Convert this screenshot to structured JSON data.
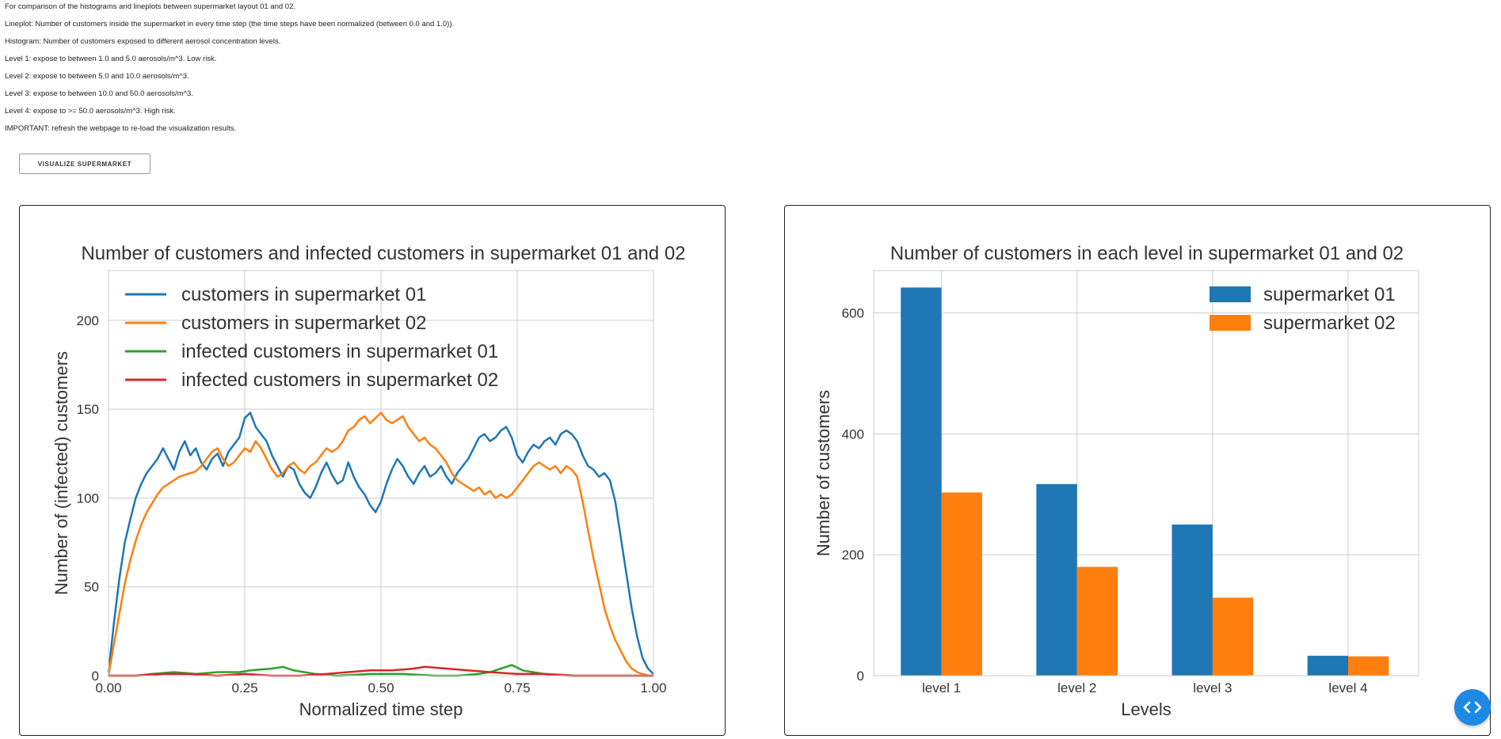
{
  "info_lines": [
    "For comparison of the histograms and lineplots between supermarket layout 01 and 02.",
    "Lineplot: Number of customers inside the supermarket in every time step (the time steps have been normalized (between 0.0 and 1.0)).",
    "Histogram: Number of customers exposed to different aerosol concentration levels.",
    "Level 1: expose to between 1.0 and 5.0 aerosols/m^3. Low risk.",
    "Level 2: expose to between 5.0 and 10.0 aerosols/m^3.",
    "Level 3: expose to between 10.0 and 50.0 aerosols/m^3.",
    "Level 4: expose to >= 50.0 aerosols/m^3. High risk.",
    "IMPORTANT: refresh the webpage to re-load the visualization results."
  ],
  "visualize_button": "VISUALIZE SUPERMARKET",
  "fab_icon": "code-icon",
  "colors": {
    "blue": "#1f77b4",
    "orange": "#ff7f0e",
    "green": "#2ca02c",
    "red": "#d62728"
  },
  "chart_data": [
    {
      "type": "line",
      "title": "Number of customers and infected customers in supermarket 01 and 02",
      "xlabel": "Normalized time step",
      "ylabel": "Number of (infected) customers",
      "xlim": [
        0.0,
        1.0
      ],
      "ylim": [
        0,
        228
      ],
      "xticks": [
        0.0,
        0.25,
        0.5,
        0.75,
        1.0
      ],
      "xtick_labels": [
        "0.00",
        "0.25",
        "0.50",
        "0.75",
        "1.00"
      ],
      "yticks": [
        0,
        50,
        100,
        150,
        200
      ],
      "ytick_labels": [
        "0",
        "50",
        "100",
        "150",
        "200"
      ],
      "grid": true,
      "legend_position": "top-left",
      "series": [
        {
          "name": "customers in supermarket 01",
          "color": "#1f77b4",
          "x": [
            0.0,
            0.01,
            0.02,
            0.03,
            0.04,
            0.05,
            0.06,
            0.07,
            0.08,
            0.09,
            0.1,
            0.11,
            0.12,
            0.13,
            0.14,
            0.15,
            0.16,
            0.17,
            0.18,
            0.19,
            0.2,
            0.21,
            0.22,
            0.23,
            0.24,
            0.25,
            0.26,
            0.27,
            0.28,
            0.29,
            0.3,
            0.31,
            0.32,
            0.33,
            0.34,
            0.35,
            0.36,
            0.37,
            0.38,
            0.39,
            0.4,
            0.41,
            0.42,
            0.43,
            0.44,
            0.45,
            0.46,
            0.47,
            0.48,
            0.49,
            0.5,
            0.51,
            0.52,
            0.53,
            0.54,
            0.55,
            0.56,
            0.57,
            0.58,
            0.59,
            0.6,
            0.61,
            0.62,
            0.63,
            0.64,
            0.65,
            0.66,
            0.67,
            0.68,
            0.69,
            0.7,
            0.71,
            0.72,
            0.73,
            0.74,
            0.75,
            0.76,
            0.77,
            0.78,
            0.79,
            0.8,
            0.81,
            0.82,
            0.83,
            0.84,
            0.85,
            0.86,
            0.87,
            0.88,
            0.89,
            0.9,
            0.91,
            0.92,
            0.93,
            0.94,
            0.95,
            0.96,
            0.97,
            0.98,
            0.99,
            1.0
          ],
          "y": [
            2,
            30,
            55,
            75,
            88,
            100,
            108,
            114,
            118,
            122,
            128,
            122,
            116,
            126,
            132,
            124,
            128,
            120,
            116,
            122,
            125,
            118,
            126,
            130,
            134,
            145,
            148,
            140,
            136,
            132,
            124,
            118,
            112,
            118,
            116,
            108,
            103,
            100,
            106,
            114,
            120,
            113,
            108,
            110,
            120,
            112,
            106,
            102,
            96,
            92,
            98,
            108,
            116,
            122,
            118,
            112,
            108,
            114,
            118,
            112,
            114,
            118,
            112,
            108,
            114,
            118,
            122,
            128,
            134,
            136,
            132,
            134,
            138,
            140,
            134,
            124,
            120,
            126,
            130,
            128,
            132,
            134,
            130,
            136,
            138,
            136,
            132,
            124,
            118,
            116,
            112,
            114,
            110,
            98,
            78,
            58,
            38,
            22,
            10,
            4,
            1
          ]
        },
        {
          "name": "customers in supermarket 02",
          "color": "#ff7f0e",
          "x": [
            0.0,
            0.01,
            0.02,
            0.03,
            0.04,
            0.05,
            0.06,
            0.07,
            0.08,
            0.09,
            0.1,
            0.11,
            0.12,
            0.13,
            0.14,
            0.15,
            0.16,
            0.17,
            0.18,
            0.19,
            0.2,
            0.21,
            0.22,
            0.23,
            0.24,
            0.25,
            0.26,
            0.27,
            0.28,
            0.29,
            0.3,
            0.31,
            0.32,
            0.33,
            0.34,
            0.35,
            0.36,
            0.37,
            0.38,
            0.39,
            0.4,
            0.41,
            0.42,
            0.43,
            0.44,
            0.45,
            0.46,
            0.47,
            0.48,
            0.49,
            0.5,
            0.51,
            0.52,
            0.53,
            0.54,
            0.55,
            0.56,
            0.57,
            0.58,
            0.59,
            0.6,
            0.61,
            0.62,
            0.63,
            0.64,
            0.65,
            0.66,
            0.67,
            0.68,
            0.69,
            0.7,
            0.71,
            0.72,
            0.73,
            0.74,
            0.75,
            0.76,
            0.77,
            0.78,
            0.79,
            0.8,
            0.81,
            0.82,
            0.83,
            0.84,
            0.85,
            0.86,
            0.87,
            0.88,
            0.89,
            0.9,
            0.91,
            0.92,
            0.93,
            0.94,
            0.95,
            0.96,
            0.97,
            0.98,
            0.99,
            1.0
          ],
          "y": [
            0,
            18,
            35,
            52,
            65,
            76,
            85,
            92,
            97,
            102,
            106,
            108,
            110,
            112,
            113,
            114,
            115,
            118,
            122,
            126,
            128,
            122,
            118,
            120,
            124,
            128,
            126,
            132,
            128,
            122,
            116,
            112,
            114,
            118,
            120,
            116,
            114,
            118,
            120,
            124,
            128,
            126,
            128,
            132,
            138,
            140,
            144,
            146,
            142,
            145,
            148,
            144,
            142,
            144,
            146,
            140,
            136,
            132,
            134,
            130,
            128,
            124,
            120,
            114,
            110,
            108,
            106,
            104,
            106,
            102,
            104,
            100,
            102,
            100,
            102,
            106,
            110,
            114,
            118,
            120,
            118,
            116,
            118,
            114,
            118,
            116,
            112,
            98,
            82,
            66,
            52,
            38,
            28,
            20,
            14,
            8,
            4,
            2,
            1,
            0,
            0
          ]
        },
        {
          "name": "infected customers in supermarket 01",
          "color": "#2ca02c",
          "x": [
            0.0,
            0.05,
            0.08,
            0.12,
            0.16,
            0.2,
            0.24,
            0.26,
            0.3,
            0.32,
            0.34,
            0.38,
            0.42,
            0.48,
            0.54,
            0.6,
            0.64,
            0.68,
            0.7,
            0.72,
            0.74,
            0.76,
            0.8,
            0.86,
            0.9,
            0.95,
            1.0
          ],
          "y": [
            0,
            0,
            1,
            2,
            1,
            2,
            2,
            3,
            4,
            5,
            3,
            1,
            0,
            1,
            1,
            0,
            0,
            1,
            2,
            4,
            6,
            3,
            1,
            0,
            0,
            0,
            0
          ]
        },
        {
          "name": "infected customers in supermarket 02",
          "color": "#d62728",
          "x": [
            0.0,
            0.05,
            0.1,
            0.15,
            0.2,
            0.25,
            0.3,
            0.35,
            0.4,
            0.44,
            0.48,
            0.52,
            0.56,
            0.58,
            0.62,
            0.66,
            0.7,
            0.75,
            0.8,
            0.85,
            0.9,
            0.95,
            1.0
          ],
          "y": [
            0,
            0,
            1,
            1,
            0,
            1,
            0,
            0,
            1,
            2,
            3,
            3,
            4,
            5,
            4,
            3,
            2,
            1,
            1,
            0,
            0,
            0,
            0
          ]
        }
      ]
    },
    {
      "type": "bar",
      "title": "Number of customers in each level in supermarket 01 and 02",
      "xlabel": "Levels",
      "ylabel": "Number of customers",
      "categories": [
        "level 1",
        "level 2",
        "level 3",
        "level 4"
      ],
      "ylim": [
        0,
        670
      ],
      "yticks": [
        0,
        200,
        400,
        600
      ],
      "ytick_labels": [
        "0",
        "200",
        "400",
        "600"
      ],
      "grid": true,
      "legend_position": "top-right",
      "series": [
        {
          "name": "supermarket 01",
          "color": "#1f77b4",
          "values": [
            642,
            317,
            250,
            33
          ]
        },
        {
          "name": "supermarket 02",
          "color": "#ff7f0e",
          "values": [
            303,
            180,
            129,
            32
          ]
        }
      ]
    }
  ]
}
